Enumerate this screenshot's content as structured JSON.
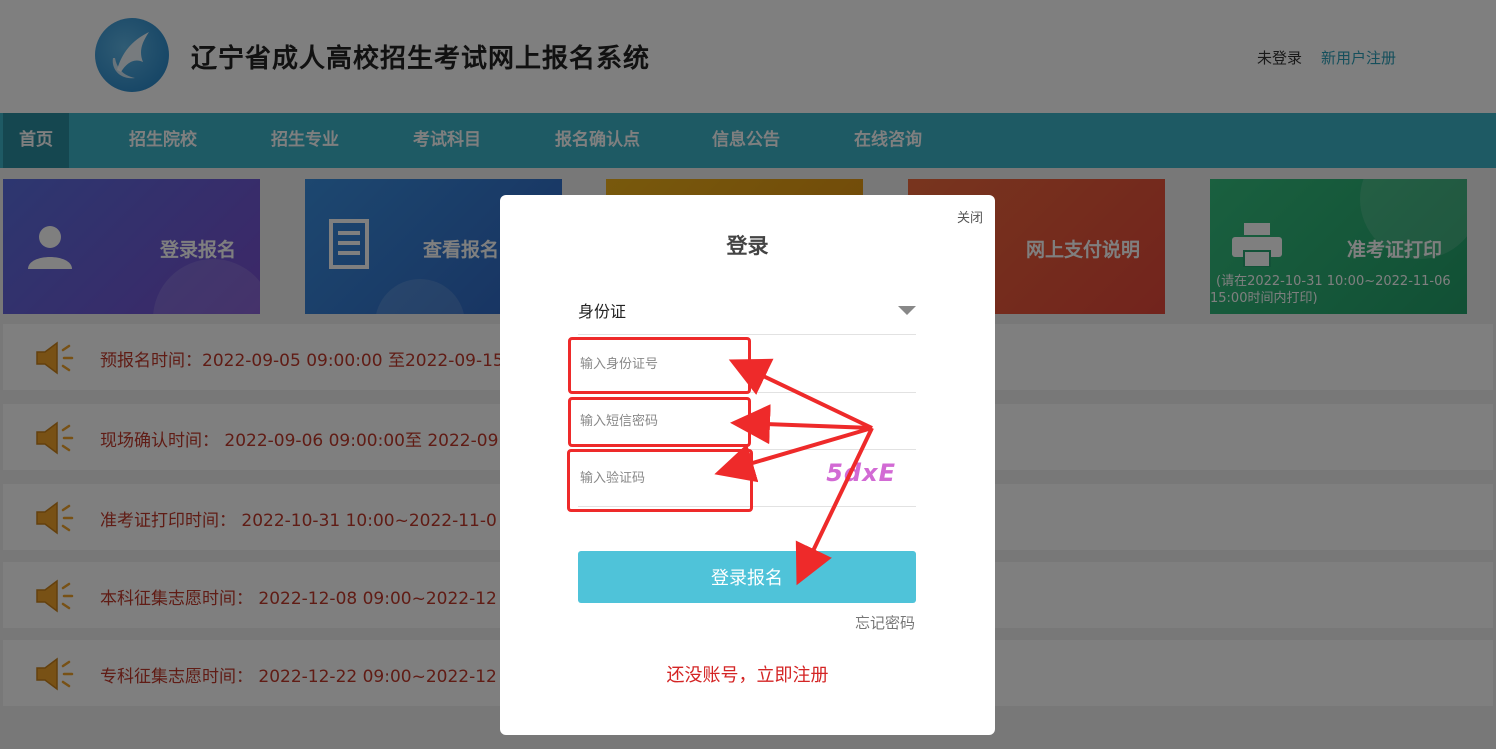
{
  "header": {
    "site_title": "辽宁省成人高校招生考试网上报名系统",
    "login_status": "未登录",
    "register_link": "新用户注册"
  },
  "nav": {
    "items": [
      "首页",
      "招生院校",
      "招生专业",
      "考试科目",
      "报名确认点",
      "信息公告",
      "在线咨询"
    ]
  },
  "tiles": [
    {
      "label": "登录报名",
      "icon": "user-icon",
      "color": "#6a5bd6"
    },
    {
      "label": "查看报名",
      "icon": "document-icon",
      "color": "#3b7fd0"
    },
    {
      "label": "",
      "icon": "",
      "color": "#e8a317"
    },
    {
      "label": "网上支付说明",
      "icon": "",
      "color": "#ea5a3c"
    },
    {
      "label": "准考证打印",
      "note": "(请在2022-10-31 10:00~2022-11-06 15:00时间内打印)",
      "icon": "printer-icon",
      "color": "#2fb37a"
    }
  ],
  "notices": [
    "预报名时间：2022-09-05 09:00:00 至2022-09-15",
    "现场确认时间： 2022-09-06 09:00:00至 2022-09",
    "准考证打印时间： 2022-10-31 10:00~2022-11-0",
    "本科征集志愿时间： 2022-12-08 09:00~2022-12",
    "专科征集志愿时间： 2022-12-22 09:00~2022-12"
  ],
  "modal": {
    "close": "关闭",
    "title": "登录",
    "id_type": "身份证",
    "id_placeholder": "输入身份证号",
    "sms_placeholder": "输入短信密码",
    "captcha_placeholder": "输入验证码",
    "captcha_text": "5dxE",
    "submit": "登录报名",
    "forgot": "忘记密码",
    "signup": "还没账号，立即注册"
  }
}
